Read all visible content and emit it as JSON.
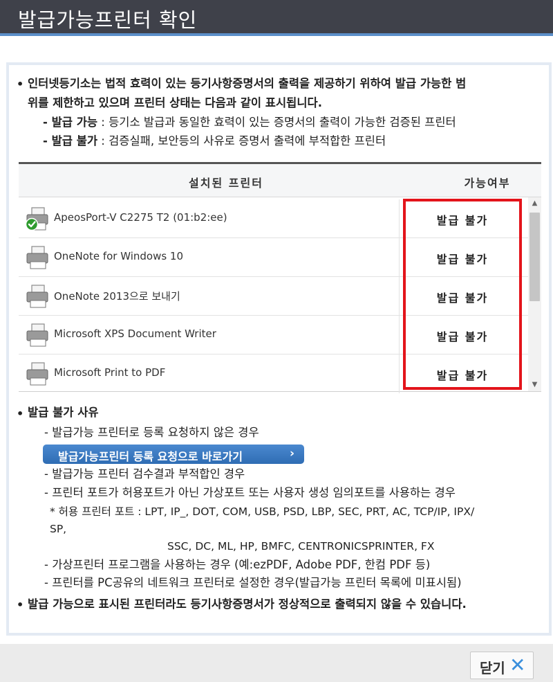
{
  "window": {
    "title": "발급가능프린터 확인"
  },
  "notice": {
    "line1": "인터넷등기소는 법적 효력이 있는 등기사항증명서의 출력을 제공하기 위하여 발급 가능한 범",
    "line2": "위를 제한하고 있으며 프린터 상태는 다음과 같이 표시됩니다.",
    "def1_term": "- 발급 가능",
    "def1_desc": " : 등기소 발급과 동일한 효력이 있는 증명서의 출력이 가능한 검증된 프린터",
    "def2_term": "- 발급 불가",
    "def2_desc": " : 검증실패, 보안등의 사유로 증명서 출력에 부적합한 프린터"
  },
  "table": {
    "col_printer": "설치된 프린터",
    "col_status": "가능여부",
    "rows": [
      {
        "name": "ApeosPort-V C2275 T2 (01:b2:ee)",
        "status": "발급 불가",
        "icon": "default-printer-icon"
      },
      {
        "name": "OneNote for Windows 10",
        "status": "발급 불가",
        "icon": "printer-icon"
      },
      {
        "name": "OneNote 2013으로 보내기",
        "status": "발급 불가",
        "icon": "printer-icon"
      },
      {
        "name": "Microsoft XPS Document Writer",
        "status": "발급 불가",
        "icon": "printer-icon"
      },
      {
        "name": "Microsoft Print to PDF",
        "status": "발급 불가",
        "icon": "printer-icon"
      }
    ]
  },
  "reasons": {
    "heading": "발급 불가 사유",
    "r1": "- 발급가능 프린터로 등록 요청하지 않은 경우",
    "link_label": "발급가능프린터 등록 요청으로 바로가기",
    "link_chevron": "›",
    "r2": "- 발급가능 프린터 검수결과 부적합인 경우",
    "r3": "- 프린터 포트가 허용포트가 아닌 가상포트 또는 사용자 생성 임의포트를 사용하는 경우",
    "r3_ports_a": "* 허용 프린터 포트 : LPT, IP_, DOT, COM, USB, PSD, LBP, SEC, PRT, AC, TCP/IP, IPX/",
    "r3_ports_b": "SP,",
    "r3_ports_c": "SSC, DC, ML, HP, BMFC, CENTRONICSPRINTER, FX",
    "r4": "- 가상프린터 프로그램을 사용하는 경우 (예:ezPDF, Adobe PDF, 한컴 PDF 등)",
    "r5": "- 프린터를 PC공유의 네트워크 프린터로 설정한 경우(발급가능 프린터 목록에 미표시됨)"
  },
  "final_note": "발급 가능으로 표시된 프린터라도 등기사항증명서가 정상적으로 출력되지 않을 수 있습니다.",
  "bullet_char": "•",
  "close": {
    "label": "닫기",
    "icon": "✕"
  },
  "colors": {
    "title_bg": "#3f414a",
    "accent": "#5b8fc9",
    "highlight": "#e3141b",
    "link": "#3a7cc5"
  }
}
